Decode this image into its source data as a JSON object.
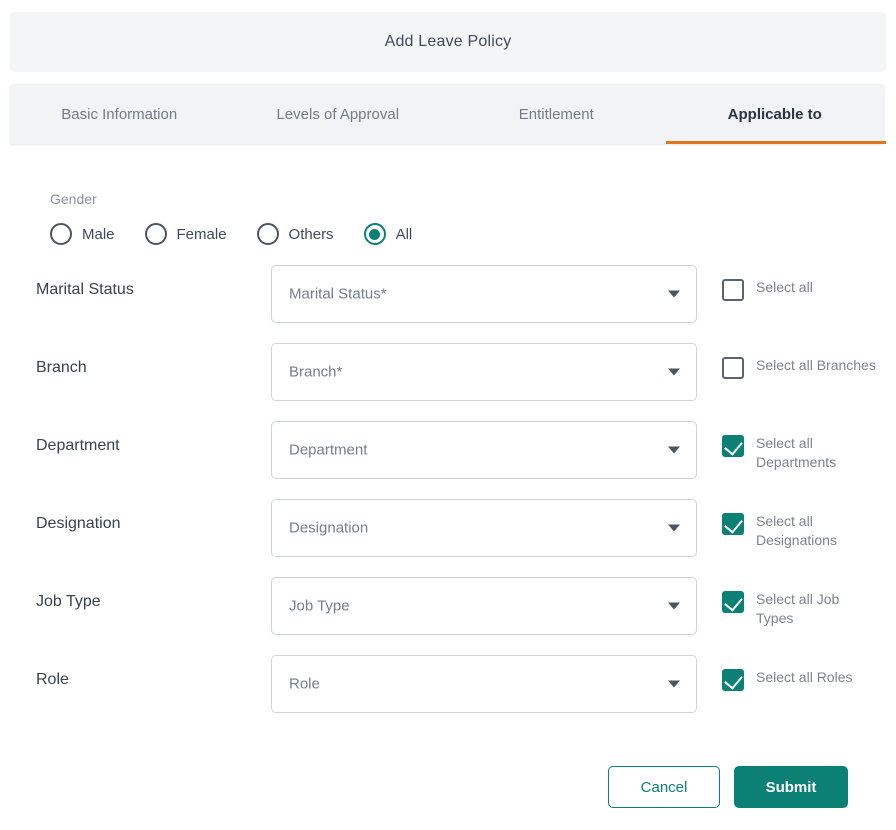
{
  "header": {
    "title": "Add Leave Policy"
  },
  "colors": {
    "accent_orange": "#e0761e",
    "accent_teal": "#0b8074",
    "header_bg": "#f4f5f6",
    "tabstrip_bg": "#f2f3f4",
    "label_text": "#39424f",
    "muted_text": "#7c848f"
  },
  "tabs": [
    {
      "label": "Basic Information",
      "active": false
    },
    {
      "label": "Levels of Approval",
      "active": false
    },
    {
      "label": "Entitlement",
      "active": false
    },
    {
      "label": "Applicable to",
      "active": true
    }
  ],
  "gender": {
    "label": "Gender",
    "options": [
      {
        "label": "Male",
        "selected": false
      },
      {
        "label": "Female",
        "selected": false
      },
      {
        "label": "Others",
        "selected": false
      },
      {
        "label": "All",
        "selected": true
      }
    ]
  },
  "rows": [
    {
      "label": "Marital Status",
      "select_placeholder": "Marital Status*",
      "select_value": "",
      "checkbox_label": "Select all",
      "checked": false
    },
    {
      "label": "Branch",
      "select_placeholder": "Branch*",
      "select_value": "",
      "checkbox_label": "Select all Branches",
      "checked": false
    },
    {
      "label": "Department",
      "select_placeholder": "Department",
      "select_value": "",
      "checkbox_label": "Select all Departments",
      "checked": true
    },
    {
      "label": "Designation",
      "select_placeholder": "Designation",
      "select_value": "",
      "checkbox_label": "Select all Designations",
      "checked": true
    },
    {
      "label": "Job Type",
      "select_placeholder": "Job Type",
      "select_value": "",
      "checkbox_label": "Select all Job Types",
      "checked": true
    },
    {
      "label": "Role",
      "select_placeholder": "Role",
      "select_value": "",
      "checkbox_label": "Select all Roles",
      "checked": true
    }
  ],
  "footer": {
    "cancel_label": "Cancel",
    "submit_label": "Submit"
  }
}
